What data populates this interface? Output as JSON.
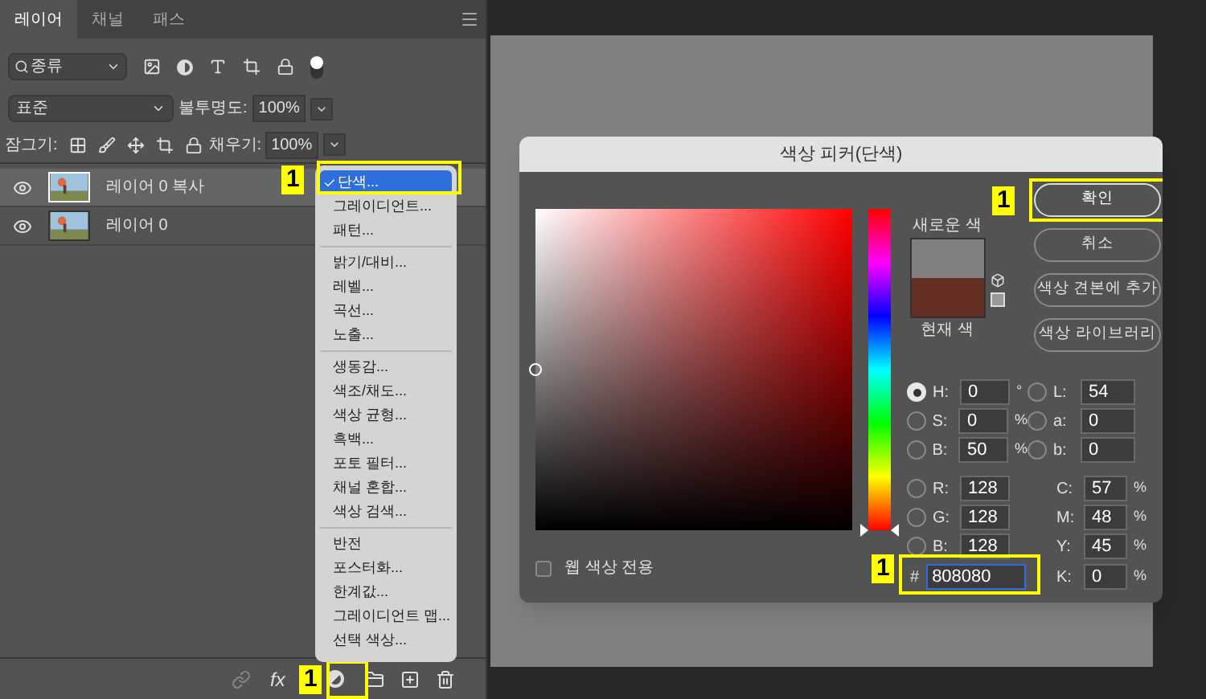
{
  "layers_panel": {
    "tabs": [
      {
        "label": "레이어",
        "selected": true
      },
      {
        "label": "채널",
        "selected": false
      },
      {
        "label": "패스",
        "selected": false
      }
    ],
    "filter": "종류",
    "blend_mode": "표준",
    "opacity_label": "불투명도:",
    "opacity": "100%",
    "lock_label": "잠그기:",
    "fill_label": "채우기:",
    "fill": "100%",
    "layers": [
      {
        "name": "레이어 0 복사",
        "selected": true,
        "visible": true
      },
      {
        "name": "레이어 0",
        "selected": false,
        "visible": true
      }
    ],
    "footer": {
      "fx": "fx",
      "callout": "1"
    }
  },
  "adjust_menu": {
    "callout": "1",
    "groups": [
      [
        {
          "label": "단색...",
          "selected": true
        },
        {
          "label": "그레이디언트...",
          "selected": false
        },
        {
          "label": "패턴...",
          "selected": false
        }
      ],
      [
        {
          "label": "밝기/대비...",
          "selected": false
        },
        {
          "label": "레벨...",
          "selected": false
        },
        {
          "label": "곡선...",
          "selected": false
        },
        {
          "label": "노출...",
          "selected": false
        }
      ],
      [
        {
          "label": "생동감...",
          "selected": false
        },
        {
          "label": "색조/채도...",
          "selected": false
        },
        {
          "label": "색상 균형...",
          "selected": false
        },
        {
          "label": "흑백...",
          "selected": false
        },
        {
          "label": "포토 필터...",
          "selected": false
        },
        {
          "label": "채널 혼합...",
          "selected": false
        },
        {
          "label": "색상 검색...",
          "selected": false
        }
      ],
      [
        {
          "label": "반전",
          "selected": false
        },
        {
          "label": "포스터화...",
          "selected": false
        },
        {
          "label": "한계값...",
          "selected": false
        },
        {
          "label": "그레이디언트 맵...",
          "selected": false
        },
        {
          "label": "선택 색상...",
          "selected": false
        }
      ]
    ]
  },
  "color_picker": {
    "title": "색상 피커(단색)",
    "new_label": "새로운 색",
    "current_label": "현재 색",
    "buttons": [
      {
        "label": "확인",
        "primary": true,
        "callout": "1"
      },
      {
        "label": "취소",
        "primary": false
      },
      {
        "label": "색상 견본에 추가",
        "primary": false
      },
      {
        "label": "색상 라이브러리",
        "primary": false
      }
    ],
    "hsb_lab": [
      [
        {
          "label": "H:",
          "value": "0",
          "unit": "°",
          "selected": true
        },
        {
          "label": "L:",
          "value": "54",
          "selected": false
        }
      ],
      [
        {
          "label": "S:",
          "value": "0",
          "unit": "%",
          "selected": false
        },
        {
          "label": "a:",
          "value": "0",
          "selected": false
        }
      ],
      [
        {
          "label": "B:",
          "value": "50",
          "unit": "%",
          "selected": false
        },
        {
          "label": "b:",
          "value": "0",
          "selected": false
        }
      ]
    ],
    "rgb_cmyk": [
      [
        {
          "label": "R:",
          "value": "128",
          "selected": false
        },
        {
          "label": "C:",
          "value": "57",
          "unit": "%"
        }
      ],
      [
        {
          "label": "G:",
          "value": "128",
          "selected": false
        },
        {
          "label": "M:",
          "value": "48",
          "unit": "%"
        }
      ],
      [
        {
          "label": "B:",
          "value": "128",
          "selected": false
        },
        {
          "label": "Y:",
          "value": "45",
          "unit": "%"
        }
      ]
    ],
    "hex_label": "#",
    "hex": "808080",
    "hex_callout": "1",
    "k": {
      "label": "K:",
      "value": "0",
      "unit": "%"
    },
    "web_only": {
      "label": "웹 색상 전용",
      "checked": false
    }
  }
}
